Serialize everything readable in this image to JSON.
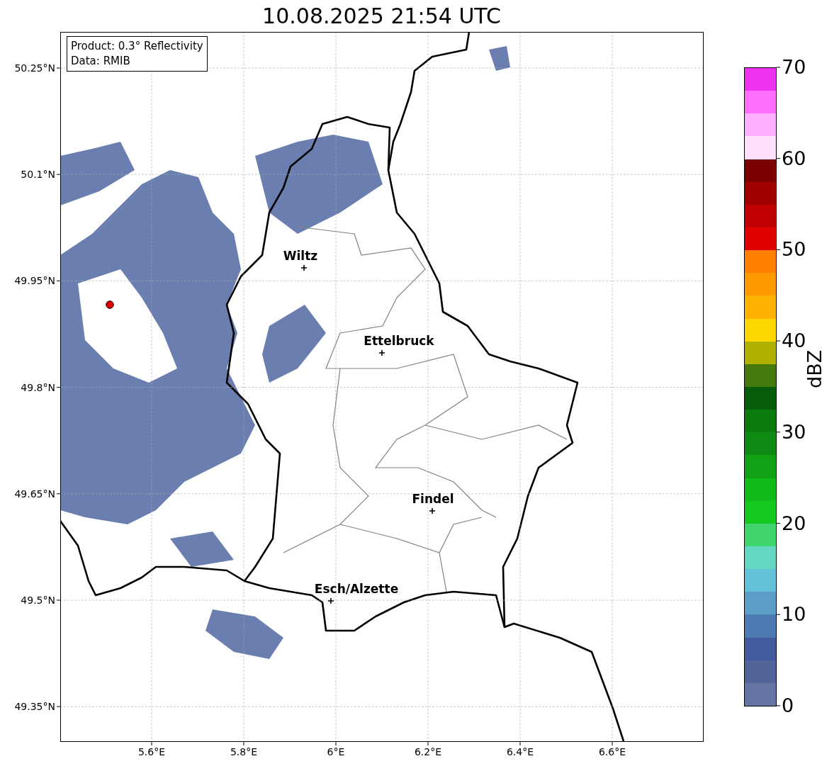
{
  "title": "10.08.2025 21:54 UTC",
  "info_box": [
    "Product: 0.3° Reflectivity",
    "Data: RMIB"
  ],
  "map": {
    "yticks": [
      "50.25°N",
      "50.1°N",
      "49.95°N",
      "49.8°N",
      "49.65°N",
      "49.5°N",
      "49.35°N"
    ],
    "xticks": [
      "5.6°E",
      "5.8°E",
      "6°E",
      "6.2°E",
      "6.4°E",
      "6.6°E"
    ],
    "cities": [
      "Wiltz",
      "Ettelbruck",
      "Findel",
      "Esch/Alzette"
    ]
  },
  "colorbar": {
    "label": "dBZ",
    "ticks": [
      "70",
      "60",
      "50",
      "40",
      "30",
      "20",
      "10",
      "0"
    ],
    "segments": [
      {
        "color": "#6475a4"
      },
      {
        "color": "#52659a"
      },
      {
        "color": "#435a9e"
      },
      {
        "color": "#4b7bb0"
      },
      {
        "color": "#5a9ec8"
      },
      {
        "color": "#63c1d9"
      },
      {
        "color": "#63d6c4"
      },
      {
        "color": "#3fd46e"
      },
      {
        "color": "#14c81e"
      },
      {
        "color": "#10bb1a"
      },
      {
        "color": "#10a214"
      },
      {
        "color": "#0e8a12"
      },
      {
        "color": "#0b7a0f"
      },
      {
        "color": "#075c0c"
      },
      {
        "color": "#437a0b"
      },
      {
        "color": "#b0b003"
      },
      {
        "color": "#ffd700"
      },
      {
        "color": "#ffb300"
      },
      {
        "color": "#ff9a00"
      },
      {
        "color": "#ff7f00"
      },
      {
        "color": "#e00000"
      },
      {
        "color": "#c00000"
      },
      {
        "color": "#a00000"
      },
      {
        "color": "#7a0000"
      },
      {
        "color": "#ffe0ff"
      },
      {
        "color": "#ffb0ff"
      },
      {
        "color": "#ff6eff"
      },
      {
        "color": "#ee33ee"
      }
    ]
  }
}
